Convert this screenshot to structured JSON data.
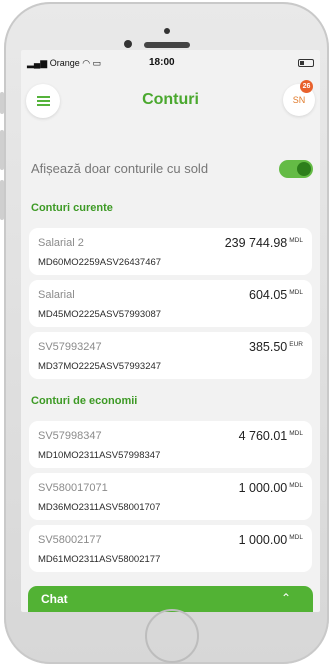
{
  "status_bar": {
    "carrier": "Orange",
    "time": "18:00"
  },
  "header": {
    "title": "Conturi",
    "avatar_initials": "SN",
    "notification_count": "26"
  },
  "filter": {
    "label": "Afișează doar conturile cu sold",
    "toggle_on": true
  },
  "sections": [
    {
      "title": "Conturi curente",
      "accounts": [
        {
          "name": "Salarial 2",
          "iban": "MD60MO2259ASV26437467",
          "amount": "239 744.98",
          "currency": "MDL"
        },
        {
          "name": "Salarial",
          "iban": "MD45MO2225ASV57993087",
          "amount": "604.05",
          "currency": "MDL"
        },
        {
          "name": "SV57993247",
          "iban": "MD37MO2225ASV57993247",
          "amount": "385.50",
          "currency": "EUR"
        }
      ]
    },
    {
      "title": "Conturi de economii",
      "accounts": [
        {
          "name": "SV57998347",
          "iban": "MD10MO2311ASV57998347",
          "amount": "4 760.01",
          "currency": "MDL"
        },
        {
          "name": "SV580017071",
          "iban": "MD36MO2311ASV58001707",
          "amount": "1 000.00",
          "currency": "MDL"
        },
        {
          "name": "SV58002177",
          "iban": "MD61MO2311ASV58002177",
          "amount": "1 000.00",
          "currency": "MDL"
        }
      ]
    }
  ],
  "chat": {
    "label": "Chat"
  },
  "colors": {
    "brand_green": "#52b234",
    "badge_orange": "#e8612c"
  }
}
